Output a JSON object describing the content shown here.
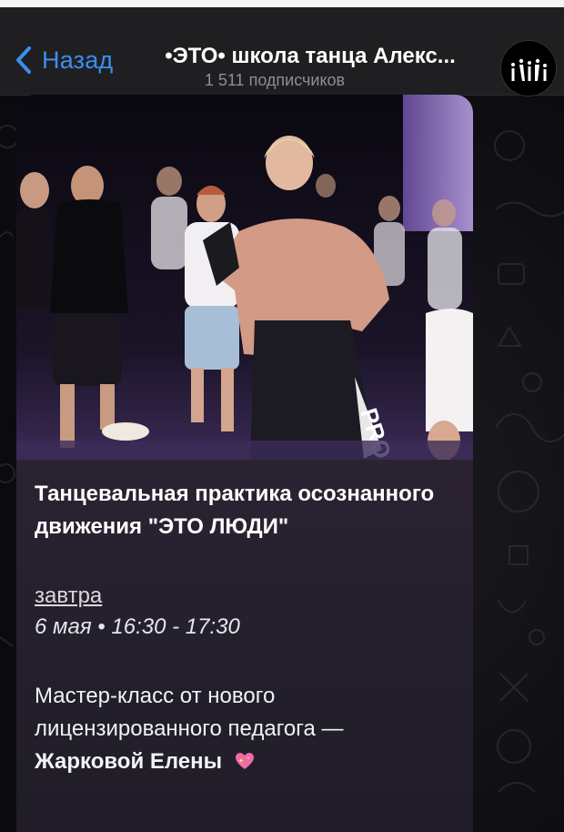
{
  "header": {
    "back_label": "Назад",
    "title": "•ЭТО• школа танца Алекс...",
    "subtitle": "1 511 подписчиков"
  },
  "post": {
    "title": "Танцевальная практика осознанного движения \"ЭТО ЛЮДИ\"",
    "date_link": "завтра",
    "datetime": "6 мая • 16:30 - 17:30",
    "description_line": "Мастер-класс от нового лицензированного педагога —",
    "teacher_name": "Жарковой Елены",
    "photo_brand_text": "PRO"
  },
  "colors": {
    "accent": "#3a8ff0",
    "header_bg": "#1f1f21",
    "bubble_top": "#3a2b3c",
    "bubble_bottom": "#1f1c27"
  },
  "icons": {
    "back": "chevron-left-icon",
    "avatar": "channel-logo-icon",
    "heart": "sparkling-heart-icon"
  }
}
